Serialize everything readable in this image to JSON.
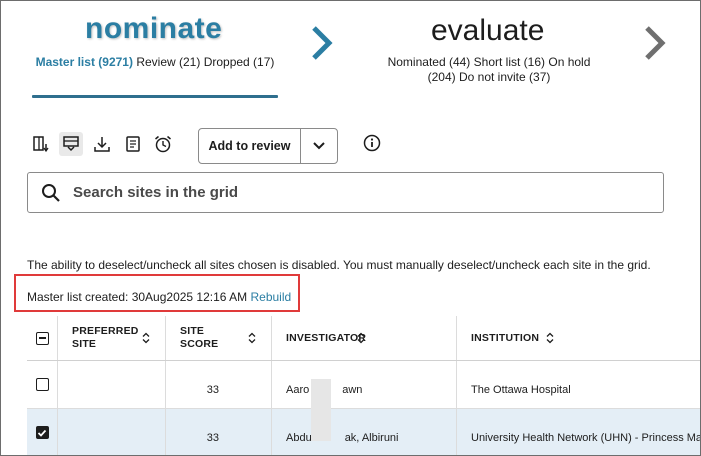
{
  "stages": {
    "nominate": {
      "title": "nominate",
      "master_list": "Master list (9271)",
      "review": "Review (21)",
      "dropped": "Dropped (17)"
    },
    "evaluate": {
      "title": "evaluate",
      "nominated": "Nominated (44)",
      "short_list": "Short list (16)",
      "on_hold": "On hold (204)",
      "do_not_invite": "Do not invite (37)"
    }
  },
  "toolbar": {
    "icons": [
      "column-add-icon",
      "column-filter-icon",
      "download-icon",
      "document-icon",
      "alarm-clock-icon",
      "info-icon"
    ],
    "add_to_review_label": "Add to review"
  },
  "search": {
    "placeholder": "Search sites in the grid",
    "value": ""
  },
  "notices": {
    "deselect_disabled": "The ability to deselect/uncheck all sites chosen is disabled. You must manually deselect/uncheck each site in the grid.",
    "master_list_created": "Master list created: 30Aug2025 12:16 AM",
    "rebuild_link": "Rebuild"
  },
  "grid": {
    "columns": [
      "PREFERRED SITE",
      "SITE SCORE",
      "INVESTIGATOR",
      "INSTITUTION"
    ],
    "column_lines": {
      "preferred": [
        "PREFERRED",
        "SITE"
      ],
      "score": [
        "SITE",
        "SCORE"
      ]
    },
    "rows": [
      {
        "checked": false,
        "preferred_site": "",
        "site_score": "33",
        "investigator": "Aaro   awn",
        "institution": "The Ottawa Hospital"
      },
      {
        "checked": true,
        "preferred_site": "",
        "site_score": "33",
        "investigator": "Abdu   ak, Albiruni",
        "institution": "University Health Network (UHN) - Princess Marga"
      }
    ]
  },
  "colors": {
    "accent": "#2b7ea3",
    "highlight_box": "#e03a3a",
    "selected_row": "#e4eef6"
  }
}
